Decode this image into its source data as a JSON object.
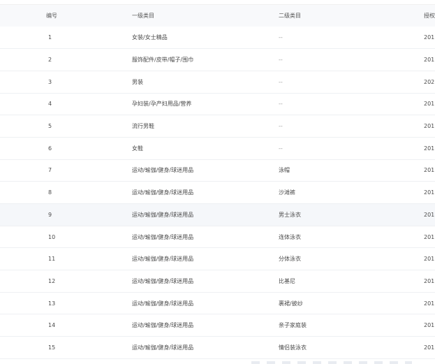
{
  "table": {
    "headers": {
      "id": "编号",
      "level1": "一级类目",
      "level2": "二级类目",
      "auth": "授权"
    },
    "rows": [
      {
        "id": "1",
        "level1": "女装/女士精品",
        "level2": "--",
        "auth": "201"
      },
      {
        "id": "2",
        "level1": "服饰配件/皮带/帽子/围巾",
        "level2": "--",
        "auth": "201"
      },
      {
        "id": "3",
        "level1": "男装",
        "level2": "--",
        "auth": "202"
      },
      {
        "id": "4",
        "level1": "孕妇装/孕产妇用品/营养",
        "level2": "--",
        "auth": "201"
      },
      {
        "id": "5",
        "level1": "流行男鞋",
        "level2": "--",
        "auth": "201"
      },
      {
        "id": "6",
        "level1": "女鞋",
        "level2": "--",
        "auth": "201"
      },
      {
        "id": "7",
        "level1": "运动/瑜伽/健身/球迷用品",
        "level2": "泳帽",
        "auth": "201"
      },
      {
        "id": "8",
        "level1": "运动/瑜伽/健身/球迷用品",
        "level2": "沙滩裤",
        "auth": "201"
      },
      {
        "id": "9",
        "level1": "运动/瑜伽/健身/球迷用品",
        "level2": "男士泳衣",
        "auth": "201"
      },
      {
        "id": "10",
        "level1": "运动/瑜伽/健身/球迷用品",
        "level2": "连体泳衣",
        "auth": "201"
      },
      {
        "id": "11",
        "level1": "运动/瑜伽/健身/球迷用品",
        "level2": "分体泳衣",
        "auth": "201"
      },
      {
        "id": "12",
        "level1": "运动/瑜伽/健身/球迷用品",
        "level2": "比基尼",
        "auth": "201"
      },
      {
        "id": "13",
        "level1": "运动/瑜伽/健身/球迷用品",
        "level2": "裹裙/披纱",
        "auth": "201"
      },
      {
        "id": "14",
        "level1": "运动/瑜伽/健身/球迷用品",
        "level2": "亲子家庭装",
        "auth": "201"
      },
      {
        "id": "15",
        "level1": "运动/瑜伽/健身/球迷用品",
        "level2": "情侣装泳衣",
        "auth": "201"
      }
    ],
    "highlighted_row_index": 8
  },
  "colors": {
    "header_bg": "#f8f9fb",
    "hover_row_bg": "#f5f7fa",
    "row_divider": "#eef0f3",
    "text": "#4a4a4a"
  }
}
